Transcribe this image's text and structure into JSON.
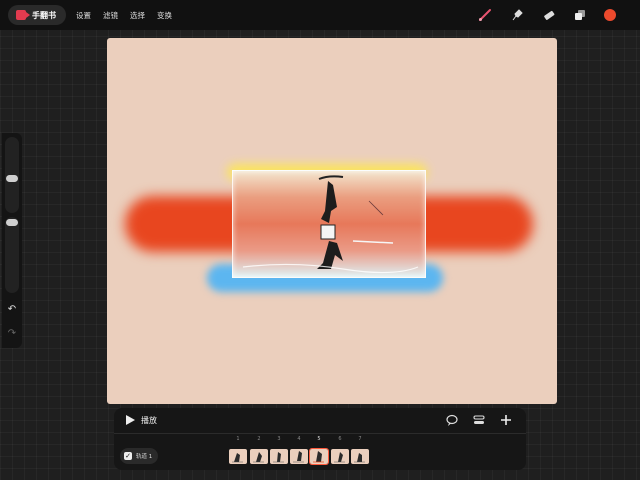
{
  "app": {
    "name": "手翻书",
    "accent": "#e23b4f"
  },
  "menu": [
    "设置",
    "滤镜",
    "选择",
    "变换"
  ],
  "tools": {
    "brush": "brush-icon",
    "smudge": "smudge-icon",
    "eraser": "eraser-icon",
    "layers": "layers-icon",
    "current_color": "#ec4a2d"
  },
  "sidebar": {
    "size_slider": 0.45,
    "opacity_slider": 0.1,
    "undo": "↶",
    "redo": "↷"
  },
  "timeline": {
    "play_label": "播放",
    "track_label": "轨道 1",
    "frames": [
      "1",
      "2",
      "3",
      "4",
      "5",
      "6",
      "7"
    ],
    "selected_frame": "5"
  }
}
